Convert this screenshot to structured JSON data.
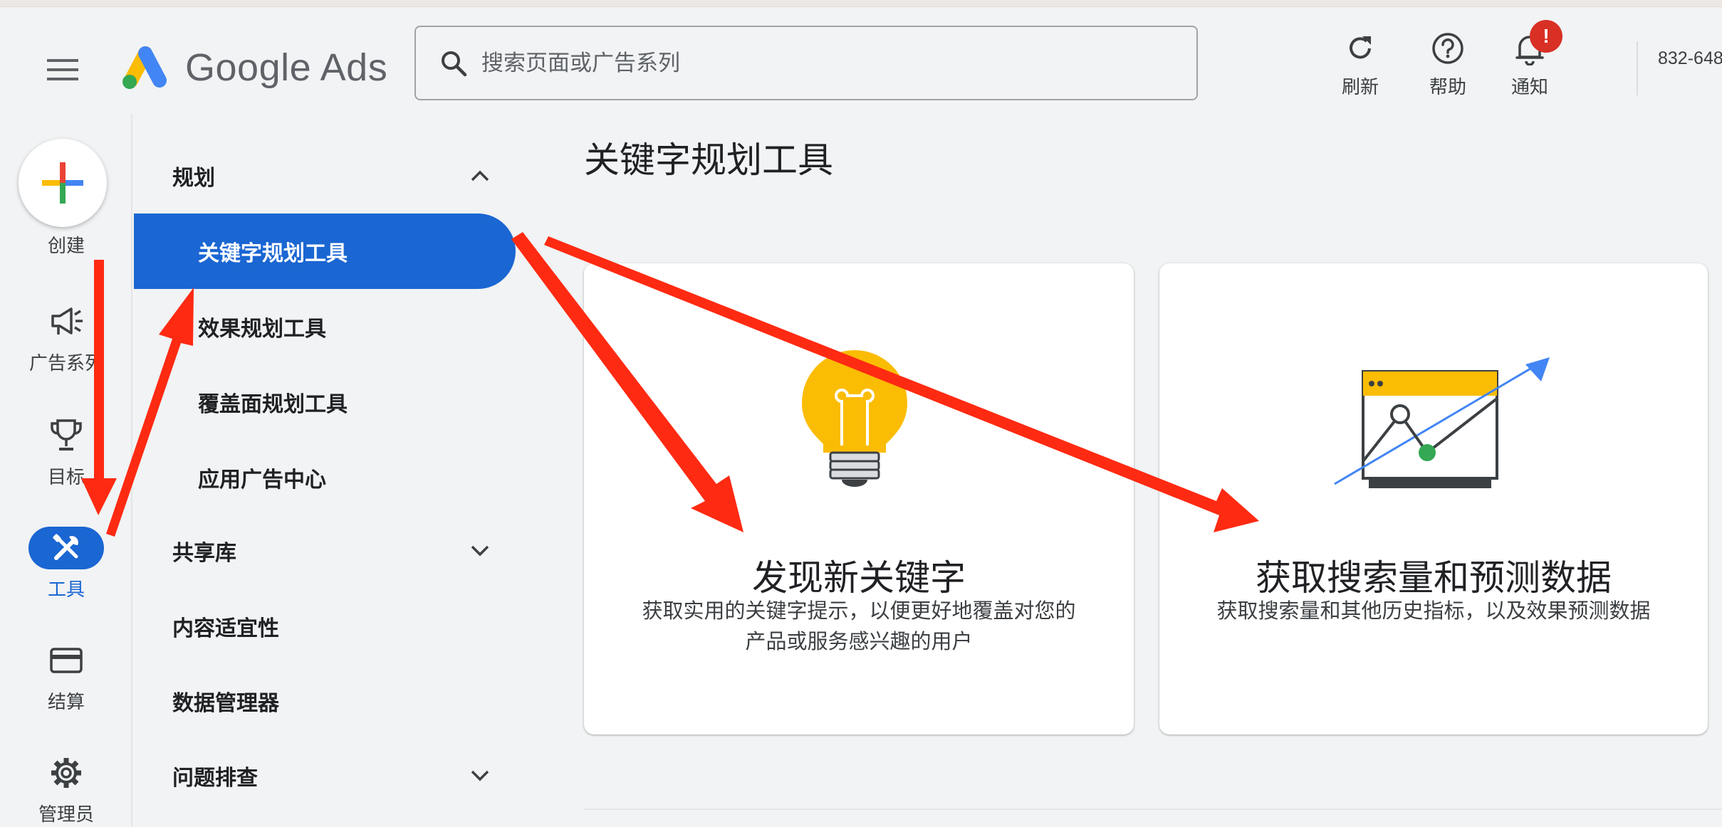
{
  "header": {
    "logo_text": "Google Ads",
    "search_placeholder": "搜索页面或广告系列",
    "refresh_label": "刷新",
    "help_label": "帮助",
    "notifications_label": "通知",
    "notification_badge": "!",
    "account_id": "832-648"
  },
  "rail": {
    "create_label": "创建",
    "campaigns_label": "广告系列",
    "goals_label": "目标",
    "tools_label": "工具",
    "billing_label": "结算",
    "admin_label": "管理员"
  },
  "subnav": {
    "planning": {
      "label": "规划",
      "items": [
        "关键字规划工具",
        "效果规划工具",
        "覆盖面规划工具",
        "应用广告中心"
      ]
    },
    "shared_library_label": "共享库",
    "content_suitability_label": "内容适宜性",
    "data_manager_label": "数据管理器",
    "troubleshooting_label": "问题排查"
  },
  "main": {
    "title": "关键字规划工具",
    "cards": [
      {
        "title": "发现新关键字",
        "desc_line1": "获取实用的关键字提示，以便更好地覆盖对您的",
        "desc_line2": "产品或服务感兴趣的用户"
      },
      {
        "title": "获取搜索量和预测数据",
        "desc_line1": "获取搜索量和其他历史指标，以及效果预测数据"
      }
    ]
  },
  "colors": {
    "accent_blue": "#1a66d2",
    "annotation_red": "#ff2a12",
    "bulb_yellow": "#fbbc04",
    "chart_green": "#34a853",
    "chart_arrow_blue": "#4285f4"
  }
}
